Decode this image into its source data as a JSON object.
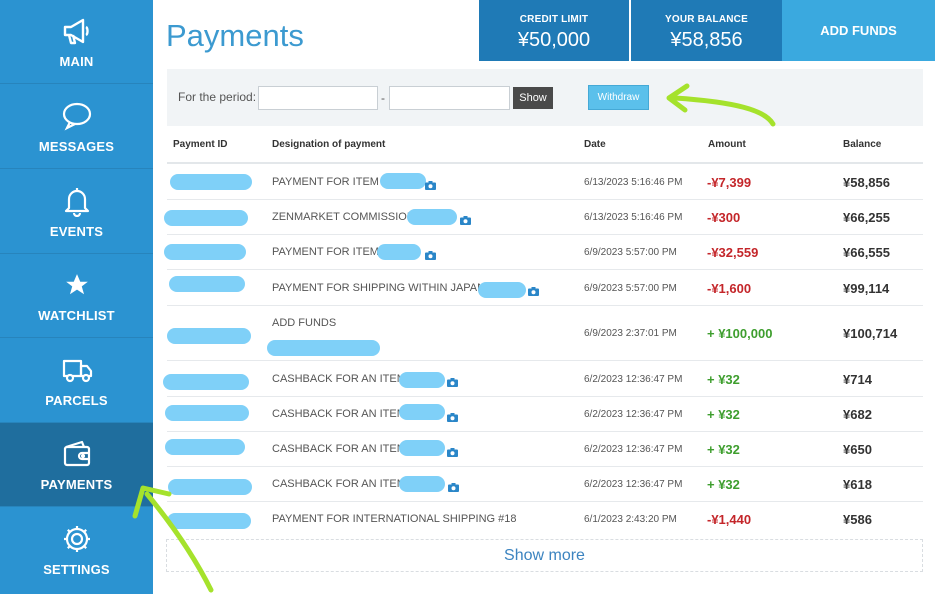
{
  "sidebar": {
    "items": [
      {
        "label": "MAIN",
        "icon": "megaphone-icon",
        "active": false
      },
      {
        "label": "MESSAGES",
        "icon": "speech-bubble-icon",
        "active": false
      },
      {
        "label": "EVENTS",
        "icon": "bell-icon",
        "active": false
      },
      {
        "label": "WATCHLIST",
        "icon": "star-icon",
        "active": false
      },
      {
        "label": "PARCELS",
        "icon": "truck-icon",
        "active": false
      },
      {
        "label": "PAYMENTS",
        "icon": "wallet-icon",
        "active": true
      },
      {
        "label": "SETTINGS",
        "icon": "gear-icon",
        "active": false
      }
    ]
  },
  "header": {
    "title": "Payments",
    "credit_limit_label": "CREDIT LIMIT",
    "credit_limit_value": "¥50,000",
    "balance_label": "YOUR BALANCE",
    "balance_value": "¥58,856",
    "add_funds_label": "ADD FUNDS"
  },
  "filter": {
    "period_label": "For the period:",
    "from_value": "",
    "separator": "-",
    "to_value": "",
    "show_label": "Show",
    "withdraw_label": "Withdraw"
  },
  "table": {
    "columns": {
      "payment_id": "Payment ID",
      "designation": "Designation of payment",
      "date": "Date",
      "amount": "Amount",
      "balance": "Balance"
    },
    "rows": [
      {
        "designation": "PAYMENT FOR ITEM",
        "date": "6/13/2023 5:16:46 PM",
        "amount": "-¥7,399",
        "balance": "¥58,856"
      },
      {
        "designation": "ZENMARKET COMMISSION",
        "date": "6/13/2023 5:16:46 PM",
        "amount": "-¥300",
        "balance": "¥66,255"
      },
      {
        "designation": "PAYMENT FOR ITEM",
        "date": "6/9/2023 5:57:00 PM",
        "amount": "-¥32,559",
        "balance": "¥66,555"
      },
      {
        "designation": "PAYMENT FOR SHIPPING WITHIN JAPAN",
        "date": "6/9/2023 5:57:00 PM",
        "amount": "-¥1,600",
        "balance": "¥99,114"
      },
      {
        "designation": "ADD FUNDS",
        "date": "6/9/2023 2:37:01 PM",
        "amount": "+ ¥100,000",
        "balance": "¥100,714"
      },
      {
        "designation": "CASHBACK FOR AN ITEM",
        "date": "6/2/2023 12:36:47 PM",
        "amount": "+ ¥32",
        "balance": "¥714"
      },
      {
        "designation": "CASHBACK FOR AN ITEM",
        "date": "6/2/2023 12:36:47 PM",
        "amount": "+ ¥32",
        "balance": "¥682"
      },
      {
        "designation": "CASHBACK FOR AN ITEM",
        "date": "6/2/2023 12:36:47 PM",
        "amount": "+ ¥32",
        "balance": "¥650"
      },
      {
        "designation": "CASHBACK FOR AN ITEM",
        "date": "6/2/2023 12:36:47 PM",
        "amount": "+ ¥32",
        "balance": "¥618"
      },
      {
        "designation": "PAYMENT FOR INTERNATIONAL SHIPPING #18",
        "date": "6/1/2023 2:43:20 PM",
        "amount": "-¥1,440",
        "balance": "¥586"
      }
    ]
  },
  "show_more_label": "Show more",
  "colors": {
    "sidebar": "#2b93d1",
    "sidebar_active": "#1f6e9e",
    "stat_box": "#1f7ab6",
    "add_funds": "#3aa9df",
    "negative": "#c4262a",
    "positive": "#3e9e2e",
    "annotation_arrow": "#a5e22c",
    "redaction": "#7fd0f8"
  }
}
